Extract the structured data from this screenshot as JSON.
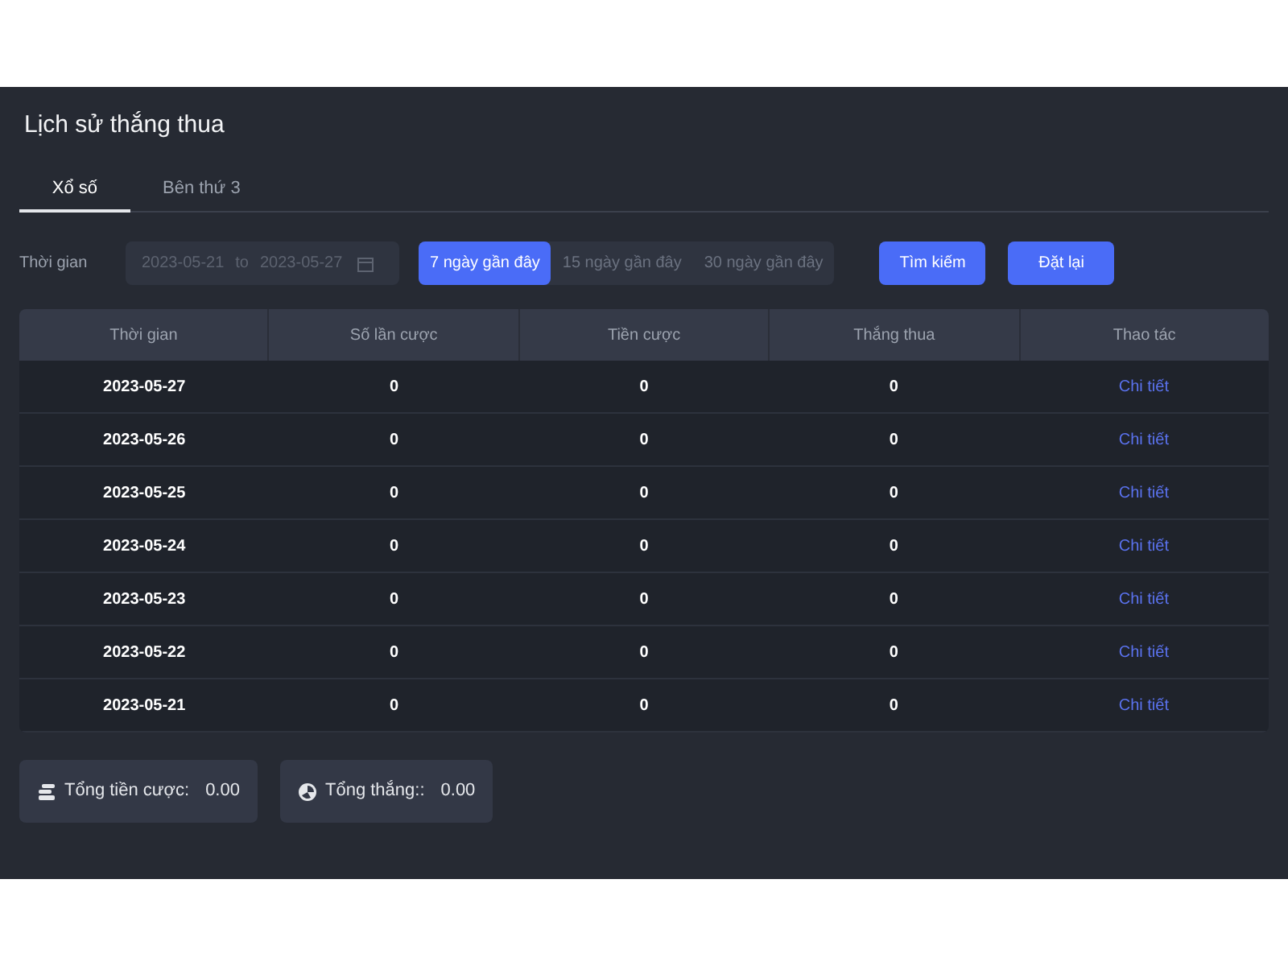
{
  "title": "Lịch sử thắng thua",
  "tabs": [
    {
      "label": "Xổ số",
      "selected": true
    },
    {
      "label": "Bên thứ 3",
      "selected": false
    }
  ],
  "filter": {
    "label": "Thời gian",
    "start": "2023-05-21",
    "separator": "to",
    "end": "2023-05-27",
    "ranges": [
      {
        "label": "7 ngày gần đây",
        "selected": true
      },
      {
        "label": "15 ngày gần đây",
        "selected": false
      },
      {
        "label": "30 ngày gần đây",
        "selected": false
      }
    ],
    "buttons": [
      "Tìm kiếm",
      "Đặt lại"
    ]
  },
  "table": {
    "columns": [
      "Thời gian",
      "Số lần cược",
      "Tiền cược",
      "Thắng thua",
      "Thao tác"
    ],
    "rows": [
      [
        "2023-05-27",
        "0",
        "0",
        "0",
        "Chi tiết"
      ],
      [
        "2023-05-26",
        "0",
        "0",
        "0",
        "Chi tiết"
      ],
      [
        "2023-05-25",
        "0",
        "0",
        "0",
        "Chi tiết"
      ],
      [
        "2023-05-24",
        "0",
        "0",
        "0",
        "Chi tiết"
      ],
      [
        "2023-05-23",
        "0",
        "0",
        "0",
        "Chi tiết"
      ],
      [
        "2023-05-22",
        "0",
        "0",
        "0",
        "Chi tiết"
      ],
      [
        "2023-05-21",
        "0",
        "0",
        "0",
        "Chi tiết"
      ]
    ]
  },
  "summary": [
    {
      "kind": "coins",
      "label": "Tổng tiền cược:",
      "value": "0.00"
    },
    {
      "kind": "chart",
      "label": "Tổng thắng::",
      "value": "0.00"
    }
  ]
}
